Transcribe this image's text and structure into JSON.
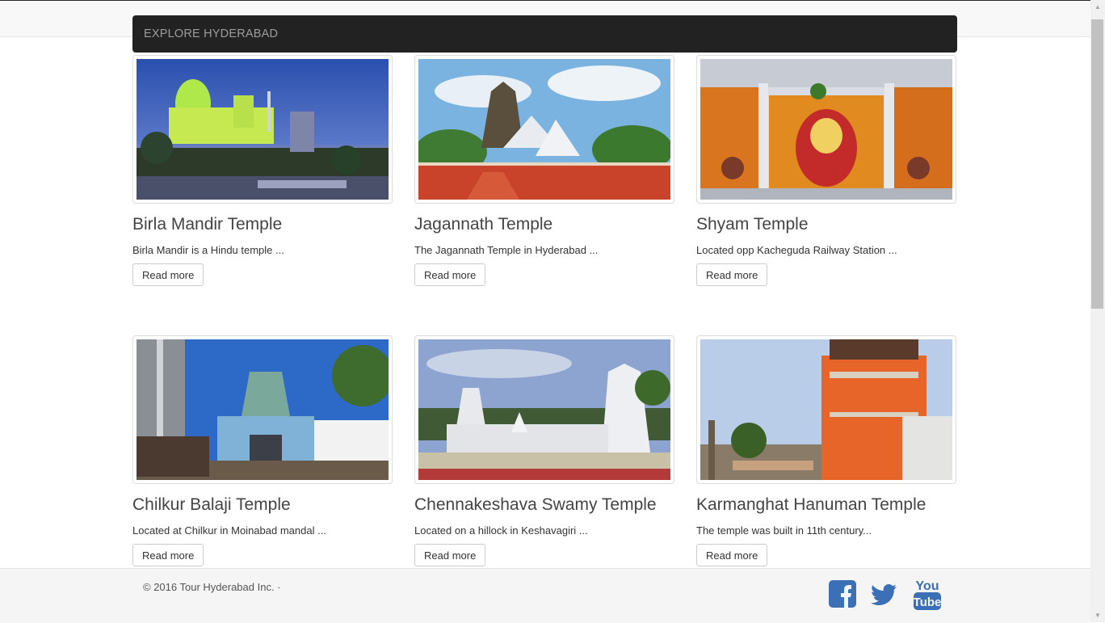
{
  "navbar": {
    "brand": "EXPLORE HYDERABAD"
  },
  "cards": [
    {
      "title": "Birla Mandir Temple",
      "desc": "Birla Mandir is a Hindu temple ...",
      "button": "Read more"
    },
    {
      "title": "Jagannath Temple",
      "desc": "The Jagannath Temple in Hyderabad ...",
      "button": "Read more"
    },
    {
      "title": "Shyam Temple",
      "desc": "Located opp Kacheguda Railway Station ...",
      "button": "Read more"
    },
    {
      "title": "Chilkur Balaji Temple",
      "desc": "Located at Chilkur in Moinabad mandal ...",
      "button": "Read more"
    },
    {
      "title": "Chennakeshava Swamy Temple",
      "desc": "Located on a hillock in Keshavagiri ...",
      "button": "Read more"
    },
    {
      "title": "Karmanghat Hanuman Temple",
      "desc": "The temple was built in 11th century...",
      "button": "Read more"
    }
  ],
  "footer": {
    "copyright": "© 2016 Tour Hyderabad Inc. ·",
    "social": [
      {
        "icon": "facebook-icon",
        "color": "#3b6fb6"
      },
      {
        "icon": "twitter-icon",
        "color": "#3b6fb6"
      },
      {
        "icon": "youtube-icon",
        "color": "#3b6fb6",
        "text_top": "You",
        "text_bottom": "Tube"
      }
    ]
  }
}
